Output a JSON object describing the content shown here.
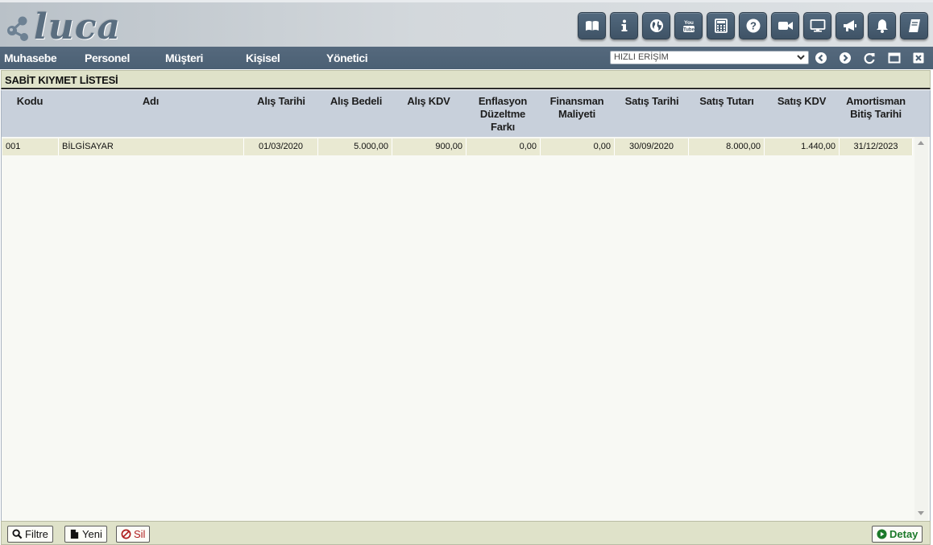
{
  "logo": {
    "text": "luca"
  },
  "toolbar": {
    "icons": [
      "book-open-icon",
      "info-icon",
      "globe-icon",
      "youtube-icon",
      "calculator-icon",
      "help-icon",
      "video-camera-icon",
      "monitor-icon",
      "megaphone-icon",
      "bell-icon",
      "notebook-icon"
    ]
  },
  "menu": {
    "items": [
      "Muhasebe",
      "Personel",
      "Müşteri",
      "Kişisel",
      "Yönetici"
    ],
    "quick_access_placeholder": "HIZLI ERİŞİM"
  },
  "page": {
    "title": "SABİT KIYMET LİSTESİ"
  },
  "table": {
    "columns": [
      "Kodu",
      "Adı",
      "Alış Tarihi",
      "Alış Bedeli",
      "Alış KDV",
      [
        "Enflasyon",
        "Düzeltme",
        "Farkı"
      ],
      [
        "Finansman",
        "Maliyeti"
      ],
      "Satış Tarihi",
      "Satış Tutarı",
      "Satış KDV",
      [
        "Amortisman",
        "Bitiş Tarihi"
      ]
    ],
    "rows": [
      {
        "kodu": "001",
        "adi": "BİLGİSAYAR",
        "alis_tarihi": "01/03/2020",
        "alis_bedeli": "5.000,00",
        "alis_kdv": "900,00",
        "enflasyon_farki": "0,00",
        "finansman_maliyeti": "0,00",
        "satis_tarihi": "30/09/2020",
        "satis_tutari": "8.000,00",
        "satis_kdv": "1.440,00",
        "amortisman_bitis": "31/12/2023"
      }
    ]
  },
  "footer": {
    "filtre": "Filtre",
    "yeni": "Yeni",
    "sil": "Sil",
    "detay": "Detay"
  },
  "colors": {
    "header_bar": "#4b6074",
    "title_strip": "#dfe2c9",
    "table_header": "#c8d0db",
    "row_fill": "#e9e9d2",
    "delete_red": "#b01e1e",
    "detail_green": "#1c7a2a"
  }
}
